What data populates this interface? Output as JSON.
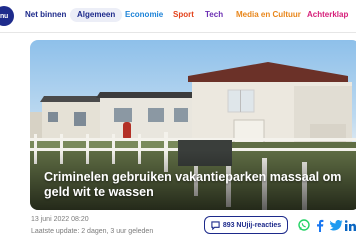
{
  "logo": {
    "text": "nu"
  },
  "nav": {
    "items": [
      {
        "label": "Net binnen",
        "color": "#1d2a8b",
        "active": false
      },
      {
        "label": "Algemeen",
        "color": "#1d2a8b",
        "active": true
      },
      {
        "label": "Economie",
        "color": "#1f84d8",
        "active": false
      },
      {
        "label": "Sport",
        "color": "#e3421b",
        "active": false
      },
      {
        "label": "Tech",
        "color": "#6c2fb3",
        "active": false
      },
      {
        "label": "Media en Cultuur",
        "color": "#e8861a",
        "active": false
      },
      {
        "label": "Achterklap",
        "color": "#d6207a",
        "active": false
      }
    ]
  },
  "article": {
    "headline": "Criminelen gebruiken vakantieparken massaal om geld wit te wassen",
    "date": "13 juni 2022 08:20",
    "last_update": "Laatste update: 2 dagen, 3 uur geleden",
    "reactions_label": "893 NUjij-reacties"
  },
  "share": {
    "icons": [
      "whatsapp-icon",
      "facebook-icon",
      "twitter-icon",
      "linkedin-icon"
    ]
  },
  "colors": {
    "brand": "#1d2a8b",
    "whatsapp": "#25d366",
    "facebook": "#1877f2",
    "twitter": "#1d9bf0",
    "linkedin": "#0a66c2"
  }
}
